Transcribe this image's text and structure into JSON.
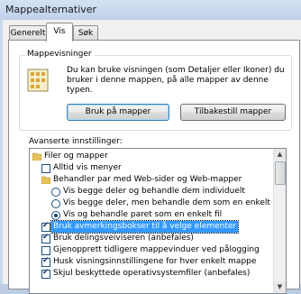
{
  "window": {
    "title": "Mappealternativer"
  },
  "tabs": [
    {
      "label": "Generelt"
    },
    {
      "label": "Vis"
    },
    {
      "label": "Søk"
    }
  ],
  "folder_views": {
    "title": "Mappevisninger",
    "description": "Du kan bruke visningen (som Detaljer eller Ikoner) du bruker i denne mappen, på alle mapper av denne typen.",
    "apply_button": "Bruk på mapper",
    "reset_button": "Tilbakestill mapper"
  },
  "advanced": {
    "label": "Avanserte innstillinger:",
    "items": [
      {
        "type": "folder",
        "text": "Filer og mapper"
      },
      {
        "type": "checkbox",
        "checked": false,
        "text": "Alltid vis menyer"
      },
      {
        "type": "folder",
        "text": "Behandler par med Web-sider og Web-mapper"
      },
      {
        "type": "radio",
        "checked": false,
        "text": "Vis begge deler og behandle dem individuelt"
      },
      {
        "type": "radio",
        "checked": false,
        "text": "Vis begge deler, men behandle dem som en enkelt fil"
      },
      {
        "type": "radio",
        "checked": true,
        "text": "Vis og behandle paret som en enkelt fil"
      },
      {
        "type": "checkbox",
        "checked": true,
        "text": "Bruk avmerkingsbokser til å velge elementer",
        "selected": true
      },
      {
        "type": "checkbox",
        "checked": true,
        "text": "Bruk delingsveiviseren (anbefales)"
      },
      {
        "type": "checkbox",
        "checked": false,
        "text": "Gjenopprett tidligere mappevinduer ved pålogging"
      },
      {
        "type": "checkbox",
        "checked": true,
        "text": "Husk visningsinnstillingene for hver enkelt mappe"
      },
      {
        "type": "checkbox",
        "checked": true,
        "text": "Skjul beskyttede operativsystemfiler (anbefales)"
      }
    ]
  },
  "icons": {
    "folder": "folder-icon",
    "folder_views": "folder-views-icon",
    "scroll_up": "scroll-up-arrow-icon",
    "scroll_down": "scroll-down-arrow-icon"
  },
  "colors": {
    "selection": "#3399ff"
  }
}
